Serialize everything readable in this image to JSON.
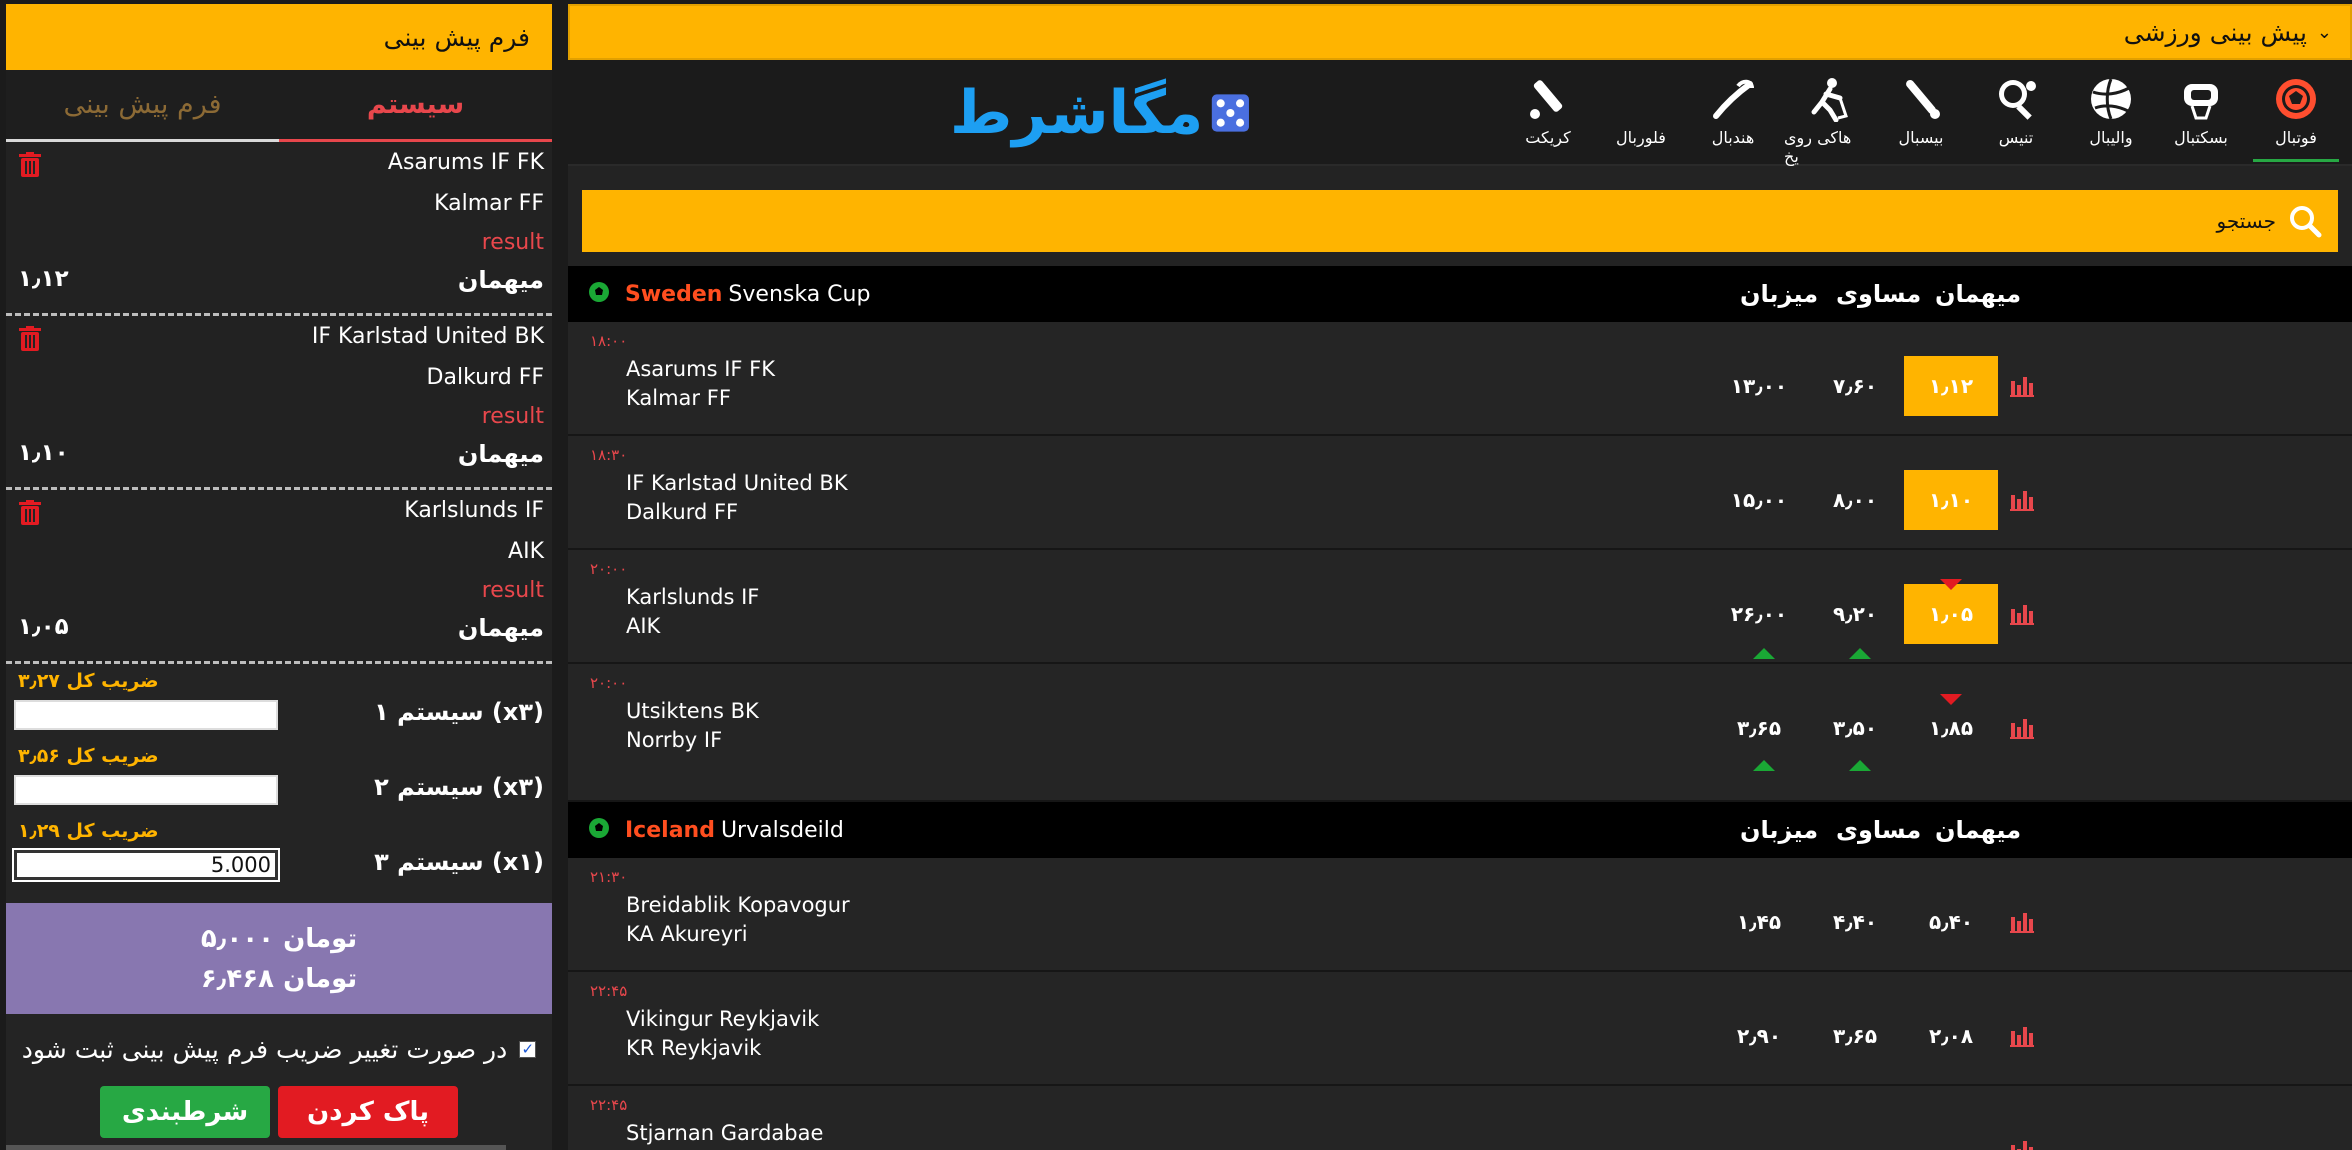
{
  "betslip": {
    "header": "فرم پیش بینی",
    "tabs": {
      "form": "فرم پیش بینی",
      "system": "سیستم"
    },
    "bets": [
      {
        "home": "Asarums IF FK",
        "away": "Kalmar FF",
        "result": "result",
        "pick": "میهمان",
        "odd": "۱٫۱۲"
      },
      {
        "home": "IF Karlstad United BK",
        "away": "Dalkurd FF",
        "result": "result",
        "pick": "میهمان",
        "odd": "۱٫۱۰"
      },
      {
        "home": "Karlslunds IF",
        "away": "AIK",
        "result": "result",
        "pick": "میهمان",
        "odd": "۱٫۰۵"
      }
    ],
    "systems": [
      {
        "total": "ضریب کل ۳٫۲۷",
        "label": "۱ سیستم (x۳)",
        "stake": ""
      },
      {
        "total": "ضریب کل ۳٫۵۶",
        "label": "۲ سیستم (x۳)",
        "stake": ""
      },
      {
        "total": "ضریب کل ۱٫۲۹",
        "label": "۳ سیستم (x۱)",
        "stake": "5.000"
      }
    ],
    "summary_stake": "تومان ۵٫۰۰۰",
    "summary_win": "تومان ۶٫۴۶۸",
    "confirm_text": "در صورت تغییر ضریب فرم پیش بینی ثبت شود",
    "bet_button": "شرطبندی",
    "clear_button": "پاک کردن"
  },
  "main": {
    "top_title": "پیش بینی ورزشی",
    "logo_text": "مگاشرط",
    "sports": [
      {
        "name": "فوتبال",
        "icon": "football-icon"
      },
      {
        "name": "بسکتبال",
        "icon": "basketball-icon"
      },
      {
        "name": "والیبال",
        "icon": "volleyball-icon"
      },
      {
        "name": "تنیس",
        "icon": "tennis-icon"
      },
      {
        "name": "بیسبال",
        "icon": "baseball-icon"
      },
      {
        "name": "هاکی روی یخ",
        "icon": "ice-hockey-icon"
      },
      {
        "name": "هندبال",
        "icon": "handball-icon"
      },
      {
        "name": "فلوربال",
        "icon": "floorball-icon"
      },
      {
        "name": "کریکت",
        "icon": "cricket-icon"
      }
    ],
    "search_placeholder": "جستجو",
    "columns": {
      "home": "میزبان",
      "draw": "مساوی",
      "away": "میهمان"
    },
    "leagues": [
      {
        "country": "Sweden",
        "name": "Svenska Cup",
        "matches": [
          {
            "time": "۱۸:۰۰",
            "home": "Asarums IF FK",
            "away": "Kalmar FF",
            "odd_home": "۱۳٫۰۰",
            "odd_draw": "۷٫۶۰",
            "odd_away": "۱٫۱۲"
          },
          {
            "time": "۱۸:۳۰",
            "home": "IF Karlstad United BK",
            "away": "Dalkurd FF",
            "odd_home": "۱۵٫۰۰",
            "odd_draw": "۸٫۰۰",
            "odd_away": "۱٫۱۰"
          },
          {
            "time": "۲۰:۰۰",
            "home": "Karlslunds IF",
            "away": "AIK",
            "odd_home": "۲۶٫۰۰",
            "odd_draw": "۹٫۲۰",
            "odd_away": "۱٫۰۵"
          },
          {
            "time": "۲۰:۰۰",
            "home": "Utsiktens BK",
            "away": "Norrby IF",
            "odd_home": "۳٫۶۵",
            "odd_draw": "۳٫۵۰",
            "odd_away": "۱٫۸۵"
          }
        ]
      },
      {
        "country": "Iceland",
        "name": "Urvalsdeild",
        "matches": [
          {
            "time": "۲۱:۳۰",
            "home": "Breidablik Kopavogur",
            "away": "KA Akureyri",
            "odd_home": "۱٫۴۵",
            "odd_draw": "۴٫۴۰",
            "odd_away": "۵٫۴۰"
          },
          {
            "time": "۲۲:۴۵",
            "home": "Vikingur Reykjavik",
            "away": "KR Reykjavik",
            "odd_home": "۲٫۹۰",
            "odd_draw": "۳٫۶۵",
            "odd_away": "۲٫۰۸"
          },
          {
            "time": "۲۲:۴۵",
            "home": "Stjarnan Gardabae",
            "away": "",
            "odd_home": "",
            "odd_draw": "",
            "odd_away": ""
          }
        ]
      }
    ]
  },
  "colors": {
    "accent": "#ffb400",
    "danger": "#e21b22",
    "success": "#27a844",
    "summary": "#8877b0",
    "logo": "#1d9ff2"
  }
}
